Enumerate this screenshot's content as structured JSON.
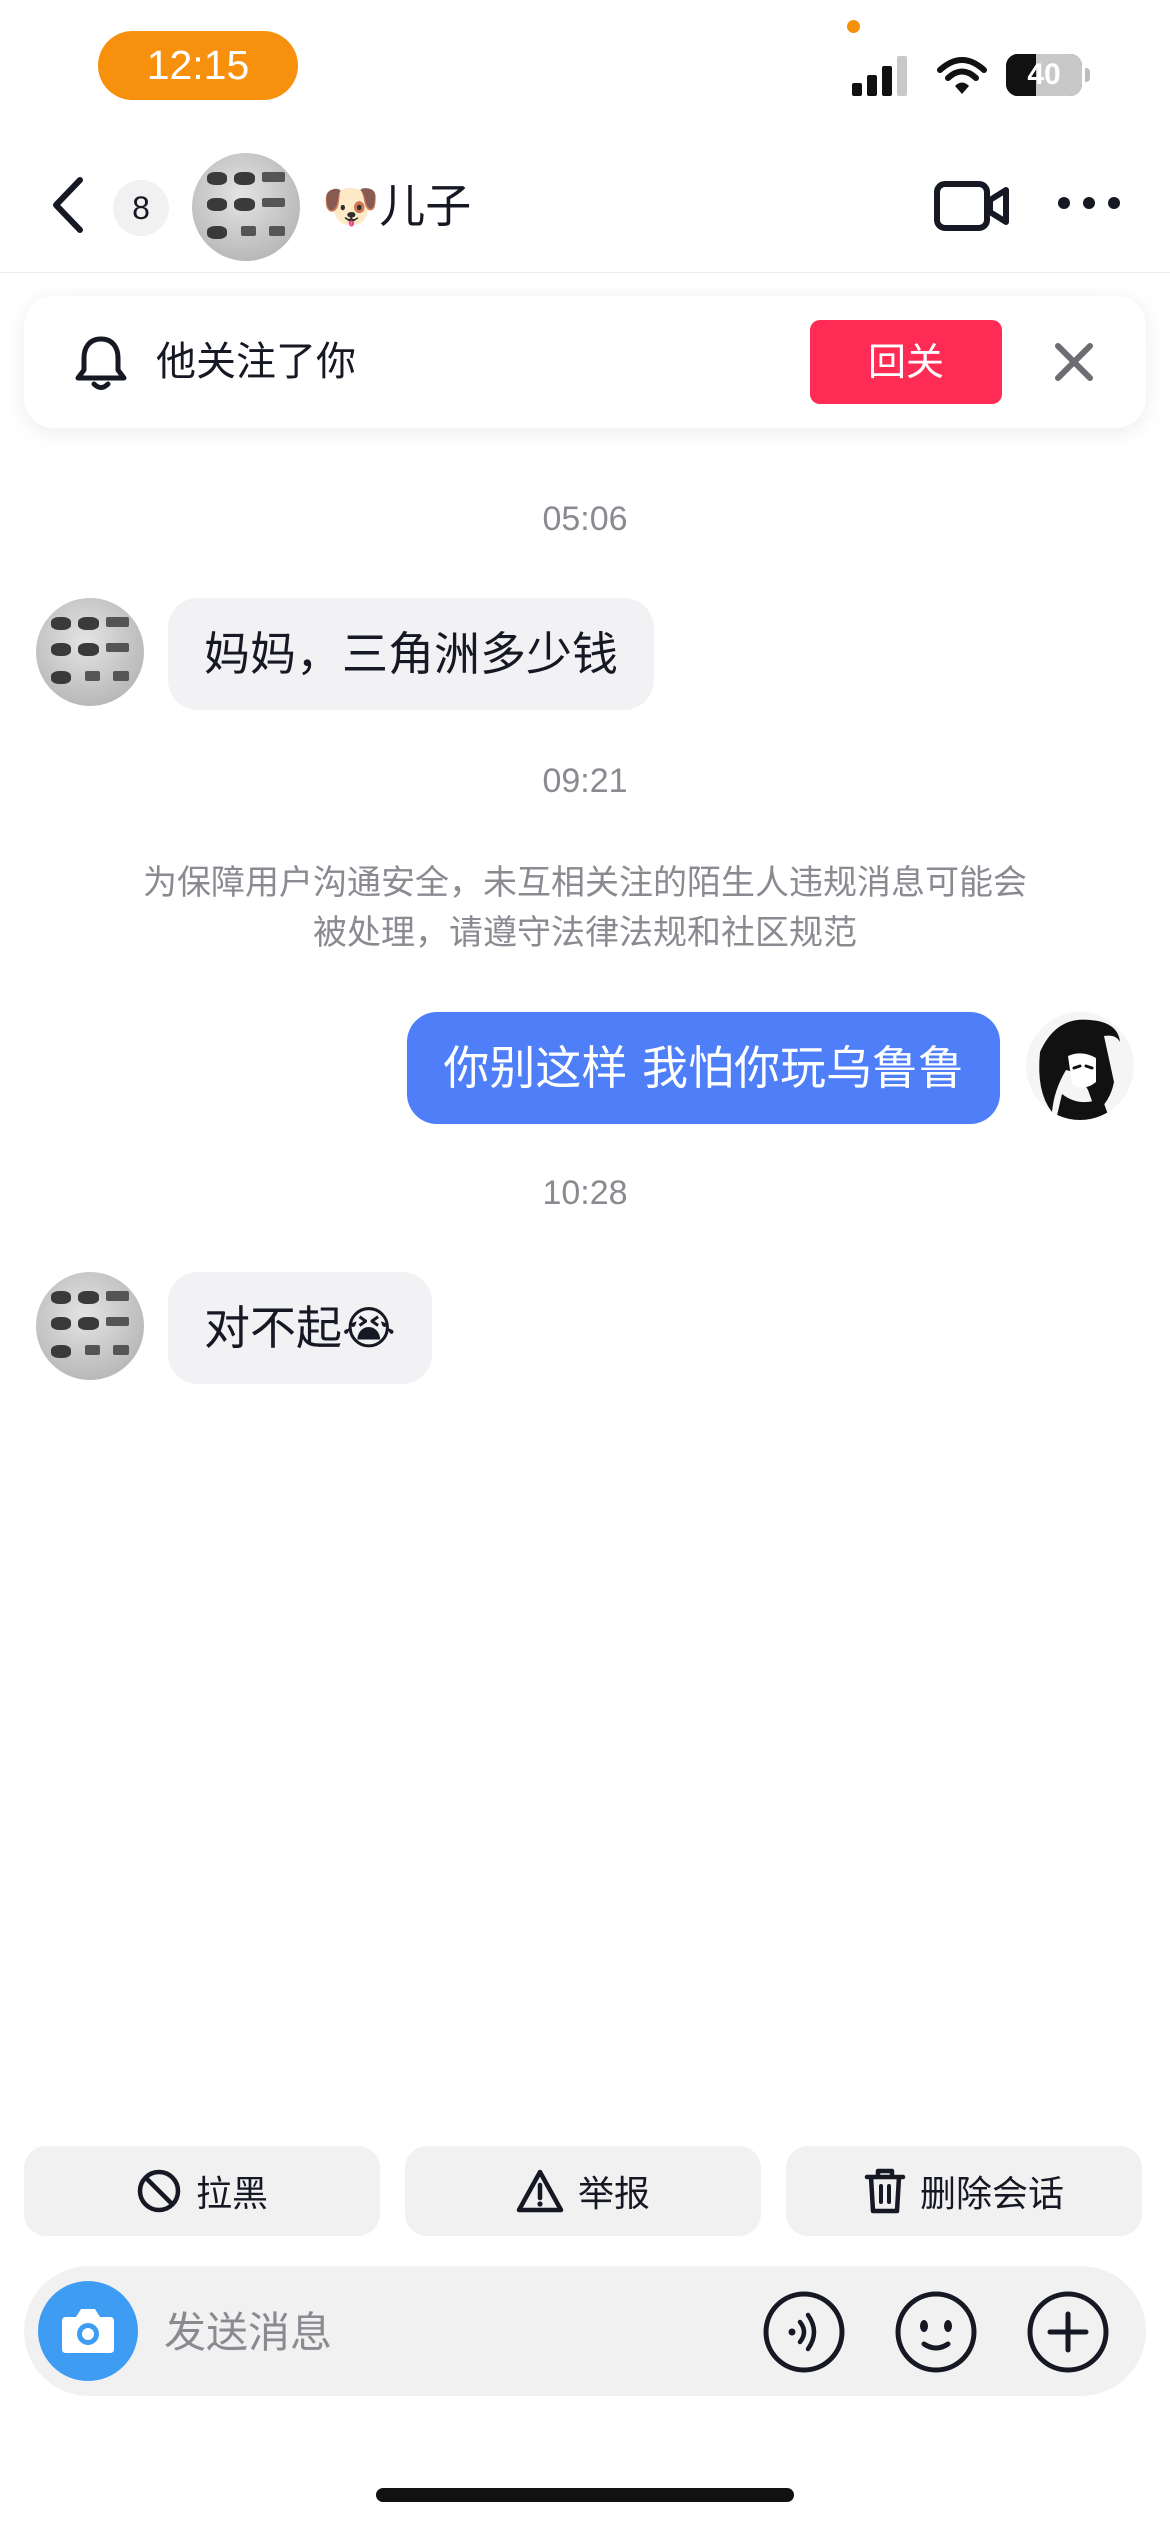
{
  "status_bar": {
    "time": "12:15",
    "battery": "40",
    "battery_level": 0.4,
    "accent_color": "#f7900c"
  },
  "header": {
    "unread_count": "8",
    "contact_name": "🐶儿子",
    "icons": [
      "back-icon",
      "video-call-icon",
      "more-icon"
    ]
  },
  "follow_banner": {
    "text": "他关注了你",
    "button_label": "回关",
    "button_color": "#fe2c55"
  },
  "messages": [
    {
      "type": "time",
      "text": "05:06"
    },
    {
      "type": "incoming",
      "text": "妈妈，三角洲多少钱"
    },
    {
      "type": "time",
      "text": "09:21"
    },
    {
      "type": "notice",
      "text": "为保障用户沟通安全，未互相关注的陌生人违规消息可能会被处理，请遵守法律法规和社区规范"
    },
    {
      "type": "outgoing",
      "text": "你别这样 我怕你玩乌鲁鲁"
    },
    {
      "type": "time",
      "text": "10:28"
    },
    {
      "type": "incoming",
      "text": "对不起😭"
    }
  ],
  "actions": {
    "block": "拉黑",
    "report": "举报",
    "delete": "删除会话"
  },
  "composer": {
    "placeholder": "发送消息",
    "icons": [
      "camera-icon",
      "voice-icon",
      "emoji-icon",
      "add-icon"
    ]
  },
  "colors": {
    "outgoing_bubble": "#4e7ff8",
    "incoming_bubble": "#f2f2f4",
    "camera_button": "#3f9cf3"
  }
}
